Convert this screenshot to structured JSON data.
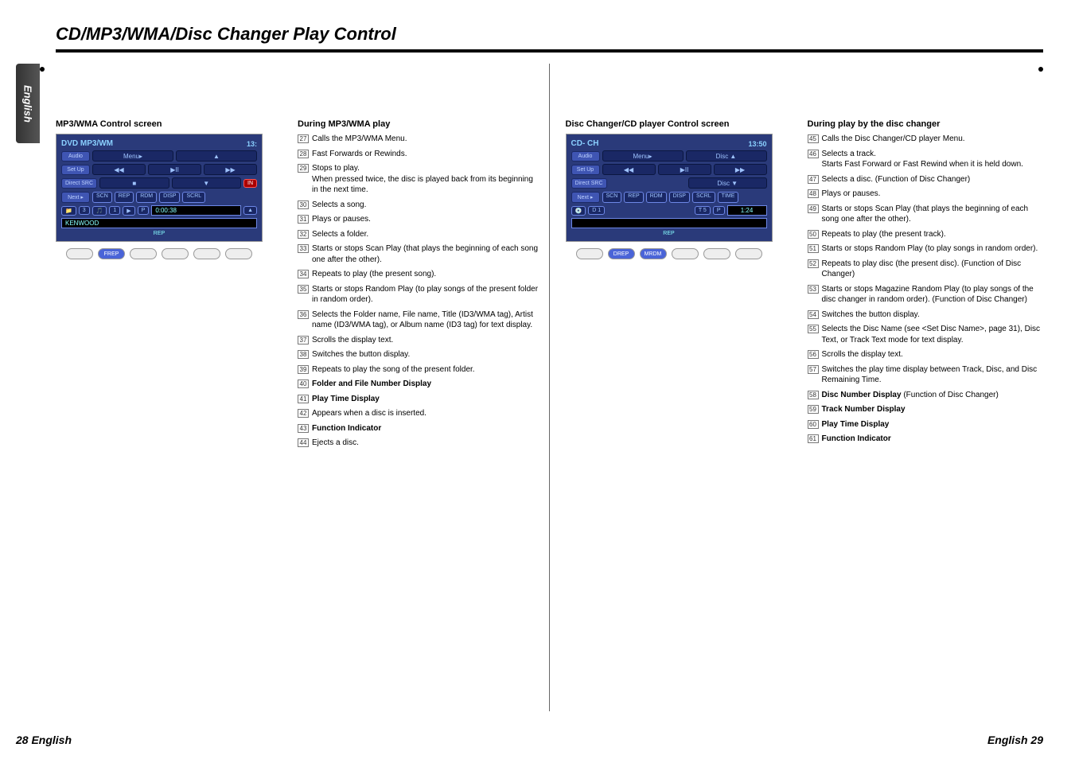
{
  "page": {
    "title": "CD/MP3/WMA/Disc Changer Play Control",
    "language_tab": "English",
    "footer_left": "28 English",
    "footer_right": "English 29"
  },
  "left": {
    "screen_label": "MP3/WMA Control screen",
    "section_title": "During MP3/WMA play",
    "mock": {
      "title": "DVD MP3/WM",
      "menu": "Menu▸",
      "time_top": "13:",
      "audio": "Audio",
      "setup": "Set Up",
      "direct": "Direct SRC",
      "next": "Next ▸",
      "scn": "SCN",
      "rep": "REP",
      "rdm": "RDM",
      "disp": "DISP",
      "scrl": "SCRL",
      "in": "IN",
      "folder": "3",
      "file": "1",
      "play": "▶",
      "p": "P",
      "playtime": "0:00:38",
      "eject": "▲",
      "track_name": "KENWOOD",
      "rep_ind": "REP",
      "frep": "FREP"
    },
    "items": [
      {
        "n": "27",
        "t": "Calls the MP3/WMA Menu."
      },
      {
        "n": "28",
        "t": "Fast Forwards or Rewinds."
      },
      {
        "n": "29",
        "t": "Stops to play.",
        "sub": "When pressed twice, the disc is played back from its beginning in the next time."
      },
      {
        "n": "30",
        "t": "Selects a song."
      },
      {
        "n": "31",
        "t": "Plays or pauses."
      },
      {
        "n": "32",
        "t": "Selects a folder."
      },
      {
        "n": "33",
        "t": "Starts or stops Scan Play (that plays the beginning of each song one after the other)."
      },
      {
        "n": "34",
        "t": "Repeats to play (the present song)."
      },
      {
        "n": "35",
        "t": "Starts or stops Random Play (to play songs of the present folder in random order)."
      },
      {
        "n": "36",
        "t": "Selects the Folder name, File name, Title (ID3/WMA tag), Artist name (ID3/WMA tag), or Album name (ID3 tag) for text display."
      },
      {
        "n": "37",
        "t": "Scrolls the display text."
      },
      {
        "n": "38",
        "t": "Switches the button display."
      },
      {
        "n": "39",
        "t": "Repeats to play the song of the present folder."
      },
      {
        "n": "40",
        "t": "Folder and File Number Display",
        "bold": true
      },
      {
        "n": "41",
        "t": "Play Time Display",
        "bold": true
      },
      {
        "n": "42",
        "t": "Appears when a disc is inserted."
      },
      {
        "n": "43",
        "t": "Function Indicator",
        "bold": true
      },
      {
        "n": "44",
        "t": "Ejects a disc."
      }
    ]
  },
  "right": {
    "screen_label": "Disc Changer/CD player Control screen",
    "section_title": "During play by the disc changer",
    "mock": {
      "title": "CD- CH",
      "menu": "Menu▸",
      "disc_up": "Disc  ▲",
      "time_top": "13:50",
      "audio": "Audio",
      "setup": "Set Up",
      "direct": "Direct SRC",
      "disc_down": "Disc  ▼",
      "next": "Next ▸",
      "scn": "SCN",
      "rep": "REP",
      "rdm": "RDM",
      "disp": "DISP",
      "scrl": "SCRL",
      "time": "TIME",
      "disc_no": "D 1",
      "track_no": "T 5",
      "p": "P",
      "playtime": "1:24",
      "rep_ind": "REP",
      "drep": "DREP",
      "mrdm": "MRDM"
    },
    "items": [
      {
        "n": "45",
        "t": "Calls the Disc Changer/CD player Menu."
      },
      {
        "n": "46",
        "t": "Selects a track.",
        "sub": "Starts Fast Forward or Fast Rewind when it is held down."
      },
      {
        "n": "47",
        "t": "Selects a disc. (Function of Disc Changer)"
      },
      {
        "n": "48",
        "t": "Plays or pauses."
      },
      {
        "n": "49",
        "t": "Starts or stops Scan Play (that plays the beginning of each song one after the other)."
      },
      {
        "n": "50",
        "t": "Repeats to play (the present track)."
      },
      {
        "n": "51",
        "t": "Starts or stops Random Play (to play songs in random order)."
      },
      {
        "n": "52",
        "t": "Repeats to play disc (the present disc). (Function of Disc Changer)"
      },
      {
        "n": "53",
        "t": "Starts or stops Magazine Random Play (to play songs of the disc changer in random order). (Function of Disc Changer)"
      },
      {
        "n": "54",
        "t": "Switches the button display."
      },
      {
        "n": "55",
        "t": "Selects the Disc Name (see <Set Disc Name>, page 31), Disc Text, or Track Text mode for text display."
      },
      {
        "n": "56",
        "t": "Scrolls the display text."
      },
      {
        "n": "57",
        "t": "Switches the play time display between Track, Disc, and Disc Remaining Time."
      },
      {
        "n": "58",
        "t": "Disc Number Display (Function of Disc Changer)",
        "boldPrefix": "Disc Number Display"
      },
      {
        "n": "59",
        "t": "Track Number Display",
        "bold": true
      },
      {
        "n": "60",
        "t": "Play Time Display",
        "bold": true
      },
      {
        "n": "61",
        "t": "Function Indicator",
        "bold": true
      }
    ]
  }
}
